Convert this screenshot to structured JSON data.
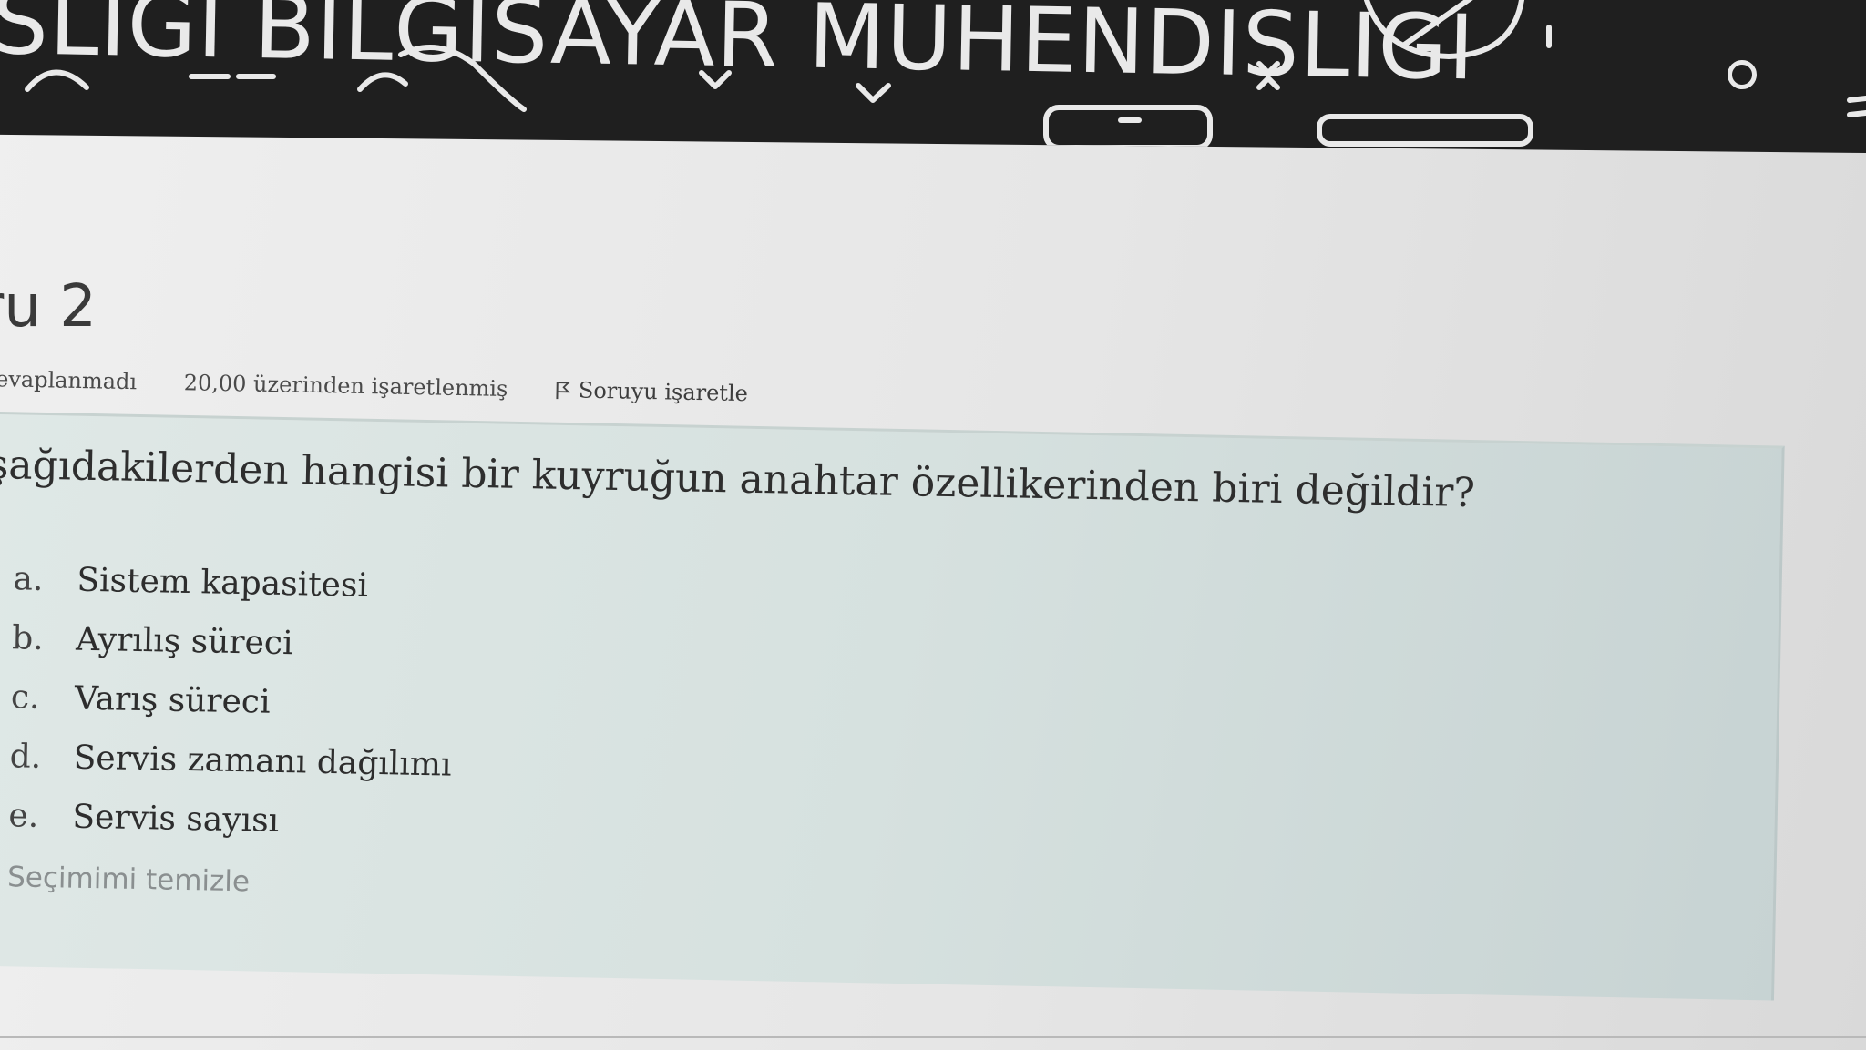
{
  "banner": {
    "title": "SLIGI BILGISAYAR MUHENDISLIGI"
  },
  "question": {
    "number_label": "ru 2",
    "status": "cevaplanmadı",
    "points": "20,00 üzerinden işaretlenmiş",
    "flag_label": "Soruyu işaretle",
    "text": "şağıdakilerden hangisi bir kuyruğun anahtar özellikerinden biri değildir?",
    "answers": [
      {
        "letter": "a.",
        "text": "Sistem kapasitesi"
      },
      {
        "letter": "b.",
        "text": "Ayrılış süreci"
      },
      {
        "letter": "c.",
        "text": "Varış süreci"
      },
      {
        "letter": "d.",
        "text": "Servis zamanı dağılımı"
      },
      {
        "letter": "e.",
        "text": "Servis sayısı"
      }
    ],
    "clear_label": "Seçimimi temizle"
  },
  "icons": {
    "flag": "flag-icon",
    "banner_circle": "circle-icon"
  },
  "colors": {
    "banner_bg": "#1f1f1f",
    "panel_bg": "#d6e1df",
    "clear_link": "#8a8f90"
  }
}
